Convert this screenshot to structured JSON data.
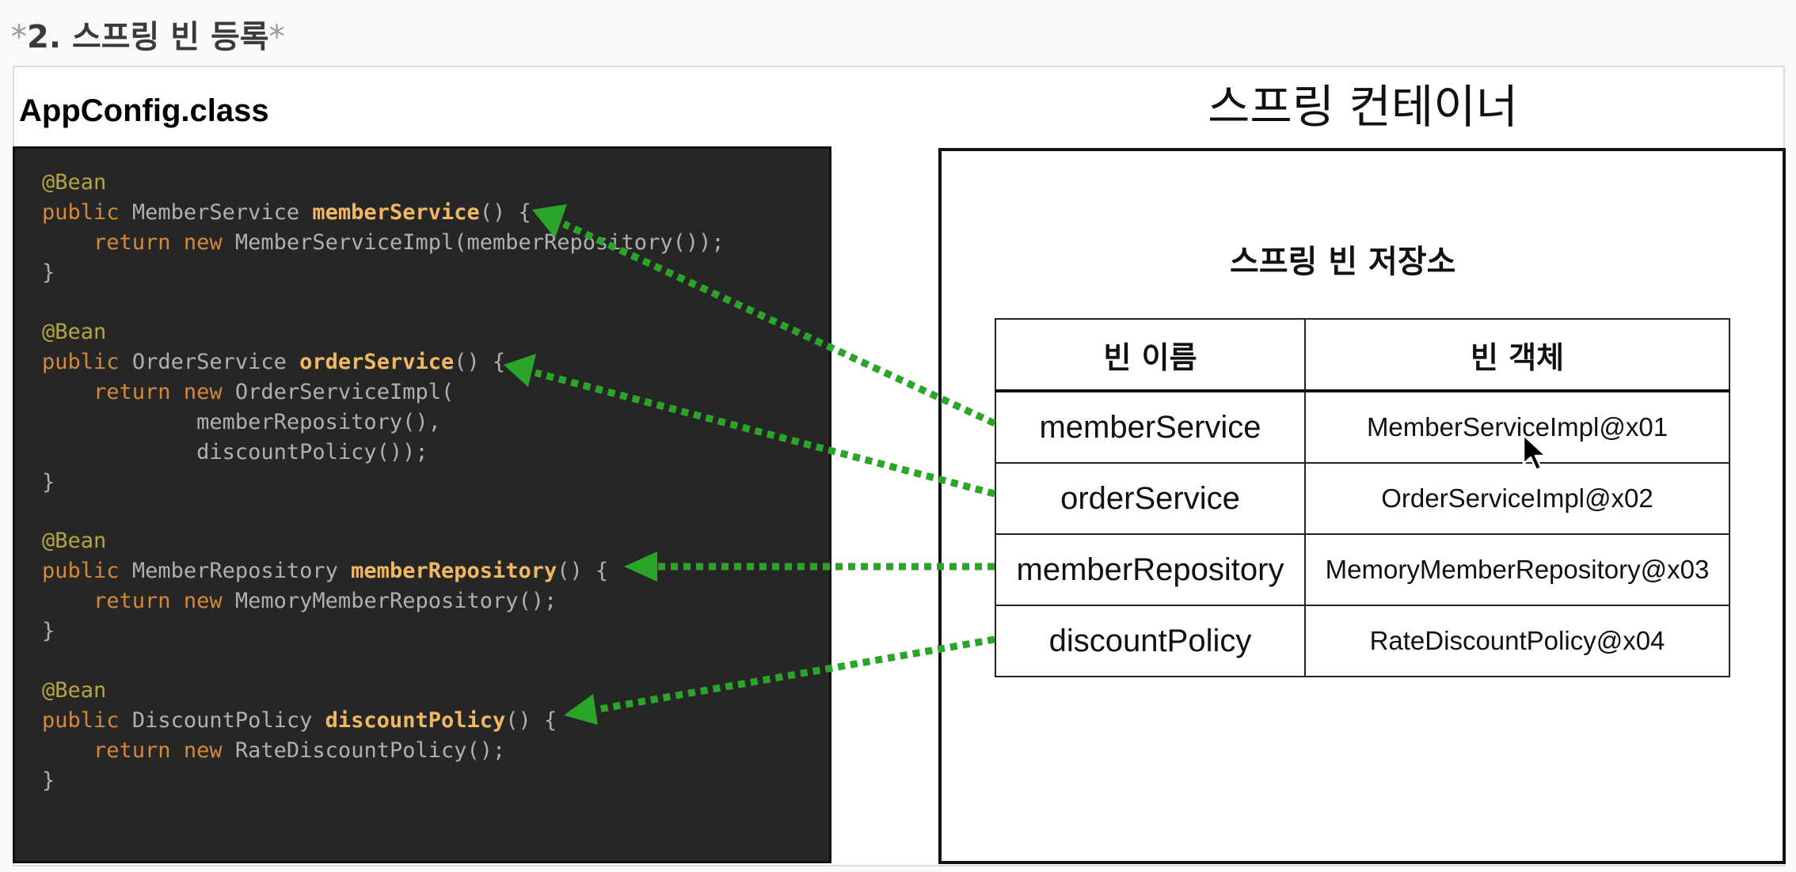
{
  "section_heading": {
    "prefix": "*",
    "text": "2. 스프링 빈 등록",
    "suffix": "*"
  },
  "config": {
    "title": "AppConfig.class"
  },
  "container": {
    "title": "스프링 컨테이너",
    "storage_title": "스프링 빈 저장소",
    "table": {
      "headers": [
        "빈 이름",
        "빈 객체"
      ],
      "rows": [
        {
          "name": "memberService",
          "object": "MemberServiceImpl@x01"
        },
        {
          "name": "orderService",
          "object": "OrderServiceImpl@x02"
        },
        {
          "name": "memberRepository",
          "object": "MemoryMemberRepository@x03"
        },
        {
          "name": "discountPolicy",
          "object": "RateDiscountPolicy@x04"
        }
      ]
    }
  },
  "code": {
    "annotation": "@Bean",
    "keywords": {
      "public": "public",
      "return": "return",
      "new": "new"
    },
    "beans": [
      {
        "return_type": "MemberService",
        "method": "memberService",
        "signature_end": "() {",
        "body": [
          "MemberServiceImpl(memberRepository());"
        ],
        "close": "}"
      },
      {
        "return_type": "OrderService",
        "method": "orderService",
        "signature_end": "() {",
        "body": [
          "OrderServiceImpl(",
          "memberRepository(),",
          "discountPolicy());"
        ],
        "close": "}"
      },
      {
        "return_type": "MemberRepository",
        "method": "memberRepository",
        "signature_end": "() {",
        "body": [
          "MemoryMemberRepository();"
        ],
        "close": "}"
      },
      {
        "return_type": "DiscountPolicy",
        "method": "discountPolicy",
        "signature_end": "() {",
        "body": [
          "RateDiscountPolicy();"
        ],
        "close": "}"
      }
    ]
  },
  "colors": {
    "arrow": "#2aa52a",
    "code_bg": "#262626",
    "annotation": "#b7a53a",
    "keyword": "#d3883a",
    "method_name": "#f1b861",
    "code_text": "#b0b0b0"
  },
  "icons": [
    "mouse-cursor-icon"
  ]
}
